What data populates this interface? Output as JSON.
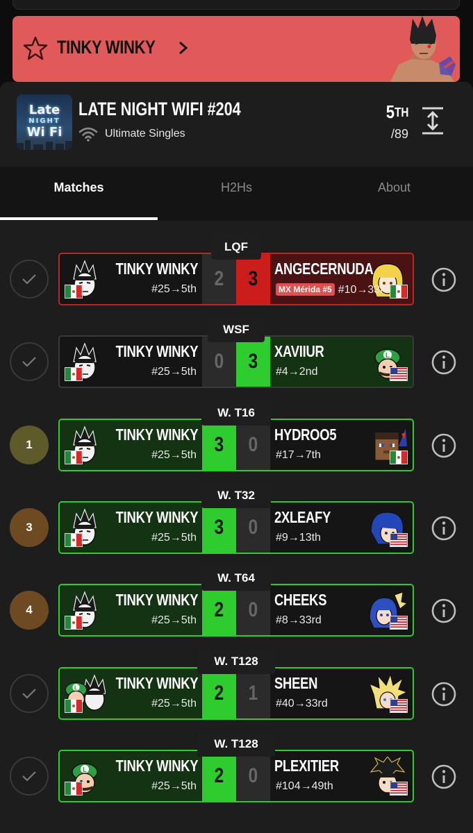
{
  "banner": {
    "player_name": "TINKY WINKY"
  },
  "tournament": {
    "logo_lines": [
      "Late",
      "NIGHT",
      "Wi Fi"
    ],
    "title": "LATE NIGHT WIFI #204",
    "format": "Ultimate Singles",
    "placement_rank": "5",
    "placement_suffix": "TH",
    "placement_total": "/89"
  },
  "tabs": [
    {
      "label": "Matches",
      "active": true
    },
    {
      "label": "H2Hs",
      "active": false
    },
    {
      "label": "About",
      "active": false
    }
  ],
  "colors": {
    "win_green": "#2fcc2f",
    "loss_red": "#cc1d1d",
    "banner_red": "#e05a5a",
    "olive": "#5e5a2a",
    "brown": "#6e4a22"
  },
  "matches": [
    {
      "round": "LQF",
      "status": "check",
      "status_text": "",
      "box": "loss",
      "p1": {
        "name": "TINKY WINKY",
        "seed": "#25→5th",
        "flag": "mx",
        "char": "kazuya",
        "score": "2"
      },
      "p2": {
        "name": "ANGECERNUDA",
        "seed": "#10→33rd",
        "tag": "MX Mérida #5",
        "flag": "mx",
        "char": "blonde",
        "score": "3"
      }
    },
    {
      "round": "WSF",
      "status": "check",
      "status_text": "",
      "box": "loss",
      "p1": {
        "name": "TINKY WINKY",
        "seed": "#25→5th",
        "flag": "mx",
        "char": "kazuya",
        "score": "0"
      },
      "p2": {
        "name": "XAVIIUR",
        "seed": "#4→2nd",
        "flag": "us",
        "char": "luigi",
        "score": "3"
      }
    },
    {
      "round": "W. T16",
      "status": "number",
      "status_text": "1",
      "box": "win",
      "p1": {
        "name": "TINKY WINKY",
        "seed": "#25→5th",
        "flag": "mx",
        "char": "kazuya",
        "score": "3"
      },
      "p2": {
        "name": "HYDROO5",
        "seed": "#17→7th",
        "flag": "mx",
        "char": "steve",
        "score": "0"
      }
    },
    {
      "round": "W. T32",
      "status": "number",
      "status_text": "3",
      "box": "win",
      "p1": {
        "name": "TINKY WINKY",
        "seed": "#25→5th",
        "flag": "mx",
        "char": "kazuya",
        "score": "3"
      },
      "p2": {
        "name": "2XLEAFY",
        "seed": "#9→13th",
        "flag": "us",
        "char": "bluehair",
        "score": "0"
      }
    },
    {
      "round": "W. T64",
      "status": "number",
      "status_text": "4",
      "box": "win",
      "p1": {
        "name": "TINKY WINKY",
        "seed": "#25→5th",
        "flag": "mx",
        "char": "kazuya",
        "score": "2"
      },
      "p2": {
        "name": "CHEEKS",
        "seed": "#8→33rd",
        "flag": "us",
        "char": "lucina",
        "score": "0"
      }
    },
    {
      "round": "W. T128",
      "status": "check",
      "status_text": "",
      "box": "win",
      "p1": {
        "name": "TINKY WINKY",
        "seed": "#25→5th",
        "flag": "mx",
        "char": "luigi_kazuya",
        "score": "2"
      },
      "p2": {
        "name": "SHEEN",
        "seed": "#40→33rd",
        "flag": "us",
        "char": "cloud",
        "score": "1"
      }
    },
    {
      "round": "W. T128",
      "status": "check",
      "status_text": "",
      "box": "win",
      "p1": {
        "name": "TINKY WINKY",
        "seed": "#25→5th",
        "flag": "mx",
        "char": "luigi",
        "score": "2"
      },
      "p2": {
        "name": "PLEXITIER",
        "seed": "#104→49th",
        "flag": "us",
        "char": "dark",
        "score": "0"
      }
    }
  ]
}
